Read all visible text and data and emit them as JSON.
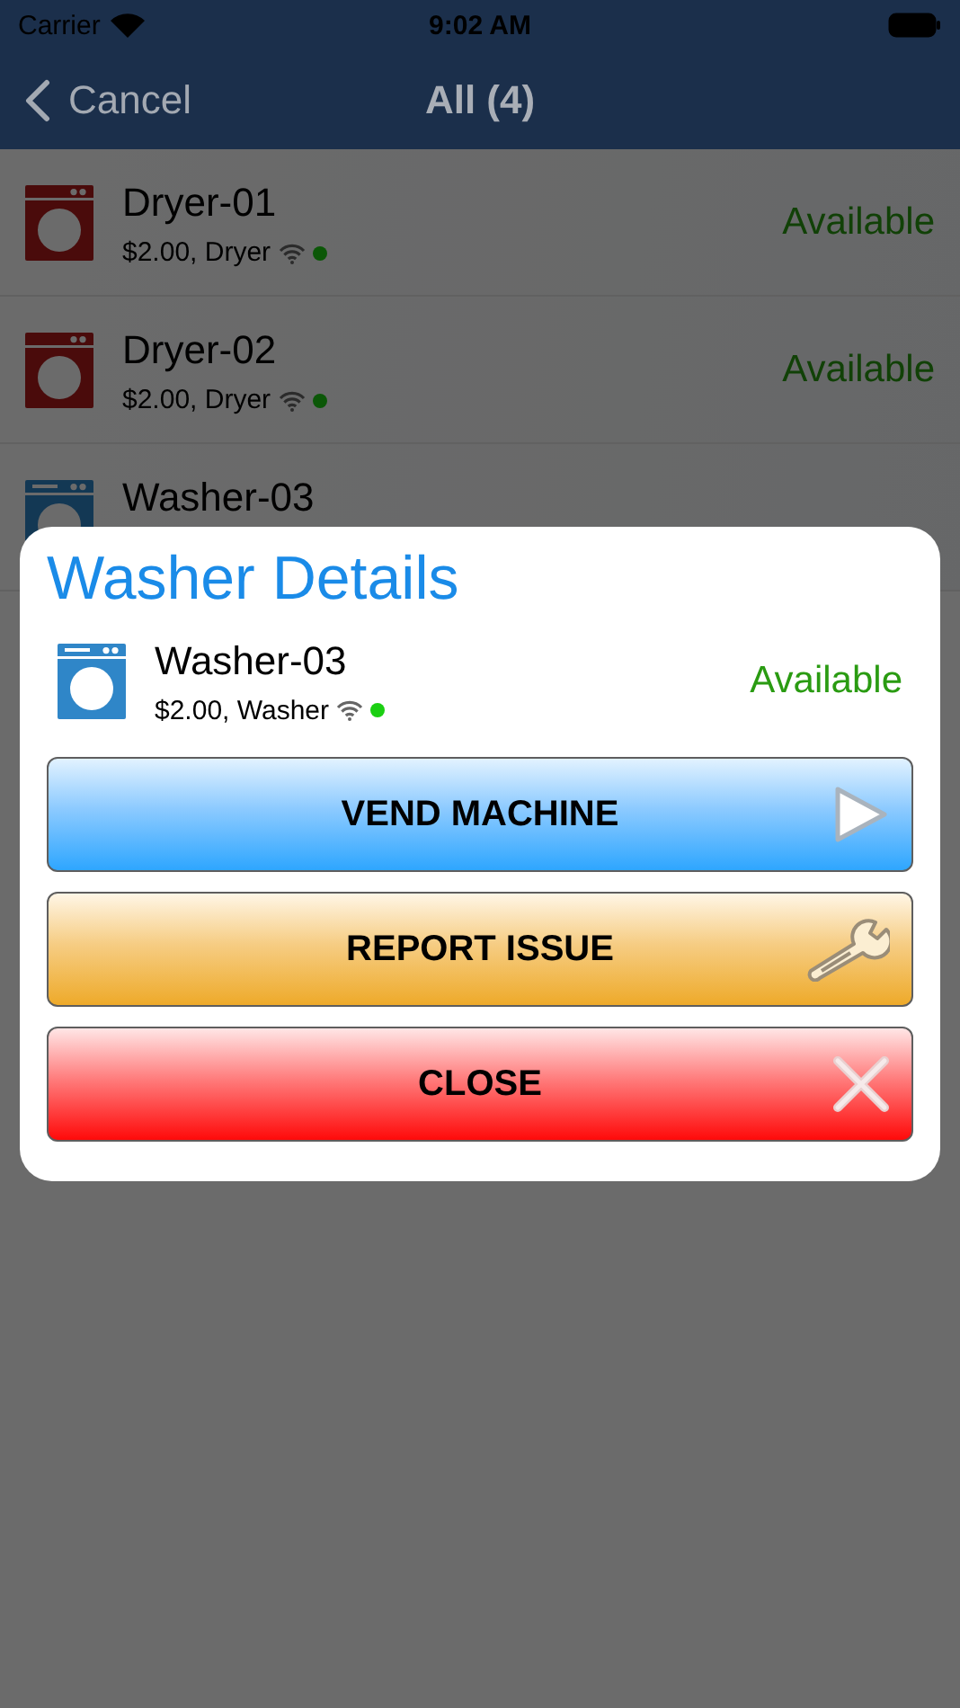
{
  "status_bar": {
    "carrier": "Carrier",
    "time": "9:02 AM"
  },
  "nav_bar": {
    "back": "Cancel",
    "title": "All (4)"
  },
  "machines": [
    {
      "kind": "dryer",
      "name": "Dryer-01",
      "details": "$2.00, Dryer",
      "online": true,
      "status": "Available"
    },
    {
      "kind": "dryer",
      "name": "Dryer-02",
      "details": "$2.00, Dryer",
      "online": true,
      "status": "Available"
    },
    {
      "kind": "washer",
      "name": "Washer-03"
    }
  ],
  "dialog": {
    "title": "Washer Details",
    "machine": {
      "kind": "washer",
      "name": "Washer-03",
      "details": "$2.00, Washer",
      "online": true,
      "status": "Available"
    },
    "buttons": [
      {
        "kind": "vend",
        "label": "VEND MACHINE"
      },
      {
        "kind": "report",
        "label": "REPORT ISSUE"
      },
      {
        "kind": "close",
        "label": "CLOSE"
      }
    ]
  }
}
